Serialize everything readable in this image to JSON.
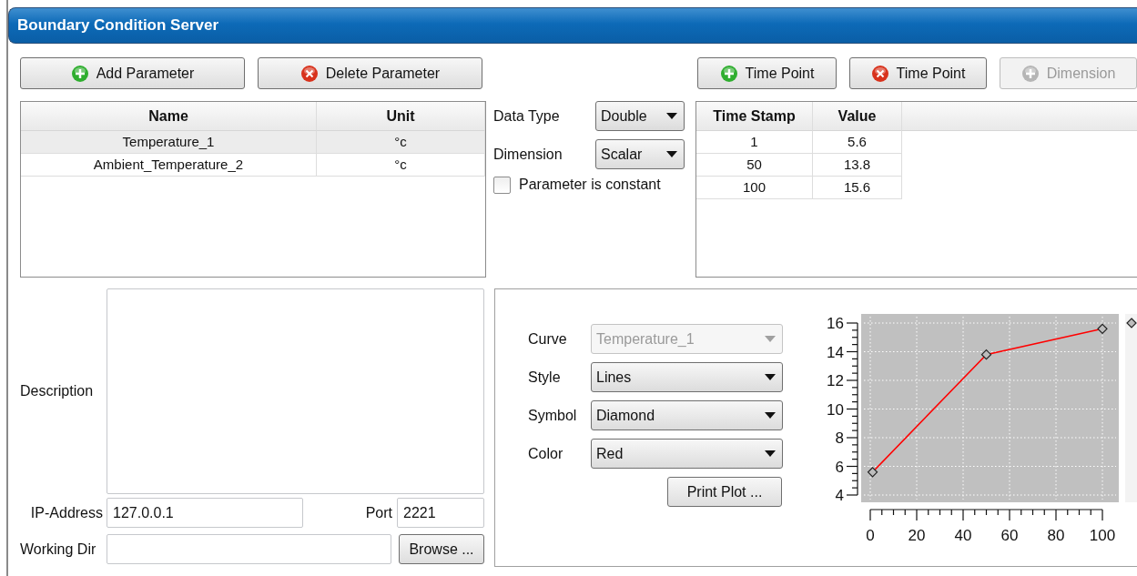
{
  "window": {
    "title": "Boundary Condition Server"
  },
  "parameter_buttons": [
    {
      "kind": "add",
      "label": "Add Parameter",
      "disabled": false
    },
    {
      "kind": "delete",
      "label": "Delete Parameter",
      "disabled": false
    }
  ],
  "time_buttons": [
    {
      "kind": "add",
      "label": "Time Point",
      "disabled": false
    },
    {
      "kind": "delete",
      "label": "Time Point",
      "disabled": false
    },
    {
      "kind": "add",
      "label": "Dimension",
      "disabled": true
    }
  ],
  "parameters": {
    "columns": [
      "Name",
      "Unit"
    ],
    "rows": [
      {
        "cells": [
          "Temperature_1",
          "°c"
        ],
        "selected": true
      },
      {
        "cells": [
          "Ambient_Temperature_2",
          "°c"
        ],
        "selected": false
      }
    ]
  },
  "settings": {
    "data_type": {
      "label": "Data Type",
      "value": "Double"
    },
    "dimension": {
      "label": "Dimension",
      "value": "Scalar"
    },
    "constant": {
      "label": "Parameter is constant",
      "checked": false
    }
  },
  "time_points": {
    "columns": [
      "Time Stamp",
      "Value"
    ],
    "rows": [
      [
        "1",
        "5.6"
      ],
      [
        "50",
        "13.8"
      ],
      [
        "100",
        "15.6"
      ]
    ]
  },
  "description": {
    "label": "Description"
  },
  "ip_address": {
    "label": "IP-Address",
    "value": "127.0.0.1"
  },
  "port": {
    "label": "Port",
    "value": "2221"
  },
  "working_dir": {
    "label": "Working Dir",
    "browse_label": "Browse ..."
  },
  "plot_settings": [
    {
      "label": "Curve",
      "value": "Temperature_1",
      "disabled": true
    },
    {
      "label": "Style",
      "value": "Lines",
      "disabled": false
    },
    {
      "label": "Symbol",
      "value": "Diamond",
      "disabled": false
    },
    {
      "label": "Color",
      "value": "Red",
      "disabled": false
    }
  ],
  "print_button": "Print Plot ...",
  "plot": {
    "chart_data": {
      "type": "line",
      "x": [
        1,
        50,
        100
      ],
      "series": [
        {
          "color": "#ff0000",
          "marker": "diamond",
          "values": [
            5.6,
            13.8,
            15.6
          ]
        }
      ],
      "xlim": [
        0,
        100
      ],
      "ylim": [
        4,
        16
      ],
      "grid": true,
      "xticks": [
        0,
        20,
        40,
        60,
        80,
        100
      ],
      "yticks": [
        4,
        6,
        8,
        10,
        12,
        14,
        16
      ]
    }
  }
}
